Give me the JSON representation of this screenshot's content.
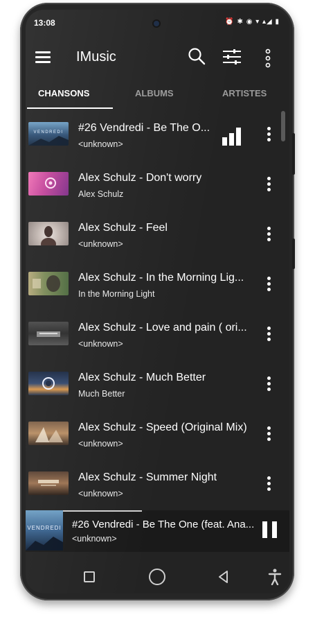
{
  "status_bar": {
    "time": "13:08",
    "icons_text": "⏰ ✱ ◉ ▾ ▴◢ ▮"
  },
  "app": {
    "title": "IMusic"
  },
  "tabs": [
    {
      "label": "CHANSONS",
      "active": true
    },
    {
      "label": "ALBUMS",
      "active": false
    },
    {
      "label": "ARTISTES",
      "active": false
    }
  ],
  "songs": [
    {
      "title": "#26 Vendredi -  Be The O...",
      "subtitle": "<unknown>",
      "playing": true
    },
    {
      "title": "Alex Schulz - Don't worry",
      "subtitle": "Alex Schulz"
    },
    {
      "title": "Alex Schulz - Feel",
      "subtitle": "<unknown>"
    },
    {
      "title": "Alex Schulz - In the Morning Lig...",
      "subtitle": "In the Morning Light"
    },
    {
      "title": "Alex Schulz - Love and pain  ( ori...",
      "subtitle": "<unknown>"
    },
    {
      "title": "Alex Schulz - Much Better",
      "subtitle": "Much Better"
    },
    {
      "title": "Alex Schulz - Speed (Original Mix)",
      "subtitle": "<unknown>"
    },
    {
      "title": "Alex Schulz - Summer Night",
      "subtitle": "<unknown>"
    }
  ],
  "now_playing": {
    "title": "#26 Vendredi -  Be The One (feat. Ana...",
    "subtitle": "<unknown>",
    "progress": 0.35,
    "art_text": "VENDREDI"
  },
  "colors": {
    "background": "#232323",
    "text": "#ffffff",
    "tab_inactive": "#9a9a9a"
  }
}
